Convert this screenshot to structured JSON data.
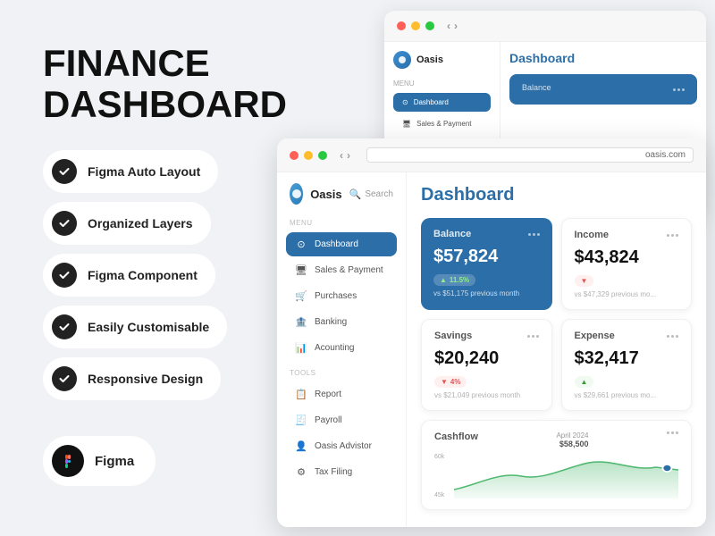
{
  "left": {
    "title_line1": "FINANCE",
    "title_line2": "DASHBOARD",
    "features": [
      {
        "label": "Figma Auto Layout"
      },
      {
        "label": "Organized Layers"
      },
      {
        "label": "Figma Component"
      },
      {
        "label": "Easily Customisable"
      },
      {
        "label": "Responsive Design"
      }
    ],
    "figma_label": "Figma"
  },
  "back_window": {
    "logo_name": "Oasis",
    "menu_label": "Menu",
    "nav_items": [
      {
        "label": "Dashboard",
        "active": true
      },
      {
        "label": "Sales & Payment"
      }
    ],
    "dashboard_title": "Dashboard",
    "balance_label": "Balance",
    "balance_amount": ""
  },
  "front_window": {
    "url": "oasis.com",
    "logo_name": "Oasis",
    "search_placeholder": "Search",
    "menu_label": "Menu",
    "nav_items": [
      {
        "label": "Dashboard",
        "icon": "⊙",
        "active": true
      },
      {
        "label": "Sales & Payment",
        "icon": "🖥"
      },
      {
        "label": "Purchases",
        "icon": "🛒"
      },
      {
        "label": "Banking",
        "icon": "🏦"
      },
      {
        "label": "Acounting",
        "icon": "📊"
      }
    ],
    "tools_label": "Tools",
    "tools_items": [
      {
        "label": "Report",
        "icon": "📋"
      },
      {
        "label": "Payroll",
        "icon": "🧾"
      },
      {
        "label": "Oasis Advistor",
        "icon": "👤"
      },
      {
        "label": "Tax Filing",
        "icon": "⚙"
      }
    ],
    "dashboard_title": "Dashboard",
    "cards": {
      "balance": {
        "label": "Balance",
        "amount": "$57,824",
        "badge": "11.5%",
        "badge_type": "up",
        "sub": "vs $51,175 previous month"
      },
      "income": {
        "label": "Income",
        "amount": "$43,824",
        "badge": "",
        "badge_type": "up",
        "sub": "vs $47,329 previous mo..."
      },
      "savings": {
        "label": "Savings",
        "amount": "$20,240",
        "badge": "4%",
        "badge_type": "down",
        "sub": "vs $21,049 previous month"
      },
      "expense": {
        "label": "Expense",
        "amount": "$32,417",
        "badge": "",
        "badge_type": "up",
        "sub": "vs $29,661 previous mo..."
      }
    },
    "cashflow": {
      "label": "Cashflow",
      "date": "April 2024",
      "amount": "$58,500",
      "y_labels": [
        "60k",
        "45k"
      ]
    }
  }
}
